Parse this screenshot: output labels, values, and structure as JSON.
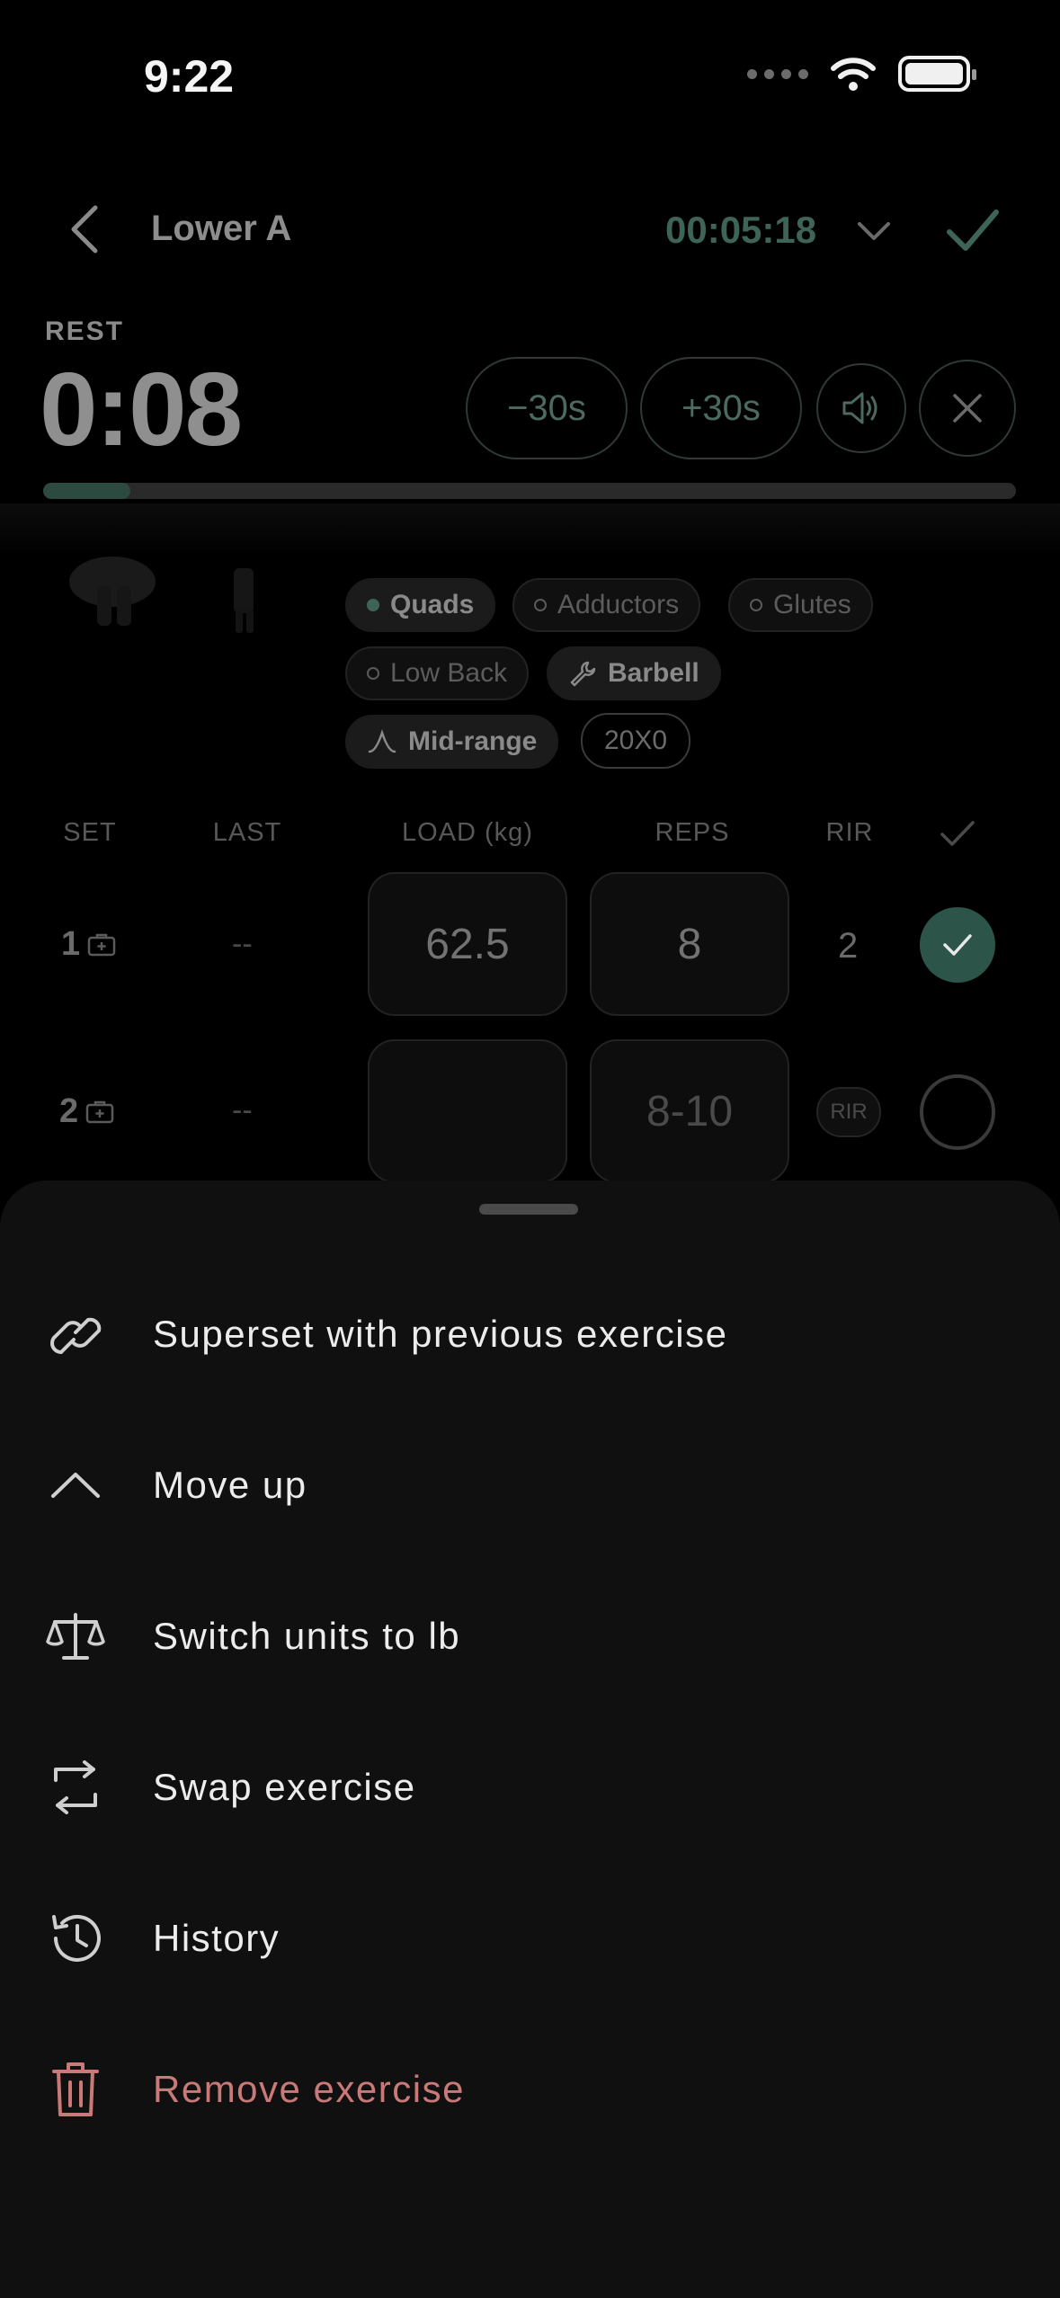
{
  "status_bar": {
    "time": "9:22"
  },
  "header": {
    "title": "Lower A",
    "elapsed": "00:05:18"
  },
  "rest_timer": {
    "label": "REST",
    "time": "0:08",
    "minus_label": "−30s",
    "plus_label": "+30s",
    "progress_fraction": 0.09,
    "accent_color": "#3d6456"
  },
  "exercise": {
    "muscles": [
      {
        "label": "Quads",
        "primary": true
      },
      {
        "label": "Adductors",
        "primary": false
      },
      {
        "label": "Glutes",
        "primary": false
      },
      {
        "label": "Low Back",
        "primary": false
      }
    ],
    "equipment": "Barbell",
    "range": "Mid-range",
    "tempo": "20X0"
  },
  "sets_table": {
    "columns": [
      "SET",
      "LAST",
      "LOAD (kg)",
      "REPS",
      "RIR"
    ],
    "rows": [
      {
        "set": "1",
        "last": "--",
        "load": "62.5",
        "reps": "8",
        "rir": "2",
        "done": true
      },
      {
        "set": "2",
        "last": "--",
        "load": "",
        "reps_placeholder": "8-10",
        "rir_placeholder": "RIR",
        "done": false
      }
    ]
  },
  "menu": {
    "items": [
      {
        "label": "Superset with previous exercise",
        "icon": "link-icon"
      },
      {
        "label": "Move up",
        "icon": "chevron-up-icon"
      },
      {
        "label": "Switch units to lb",
        "icon": "scale-icon"
      },
      {
        "label": "Swap exercise",
        "icon": "swap-icon"
      },
      {
        "label": "History",
        "icon": "history-icon"
      },
      {
        "label": "Remove exercise",
        "icon": "trash-icon",
        "destructive": true,
        "color": "#c97a78"
      }
    ]
  }
}
